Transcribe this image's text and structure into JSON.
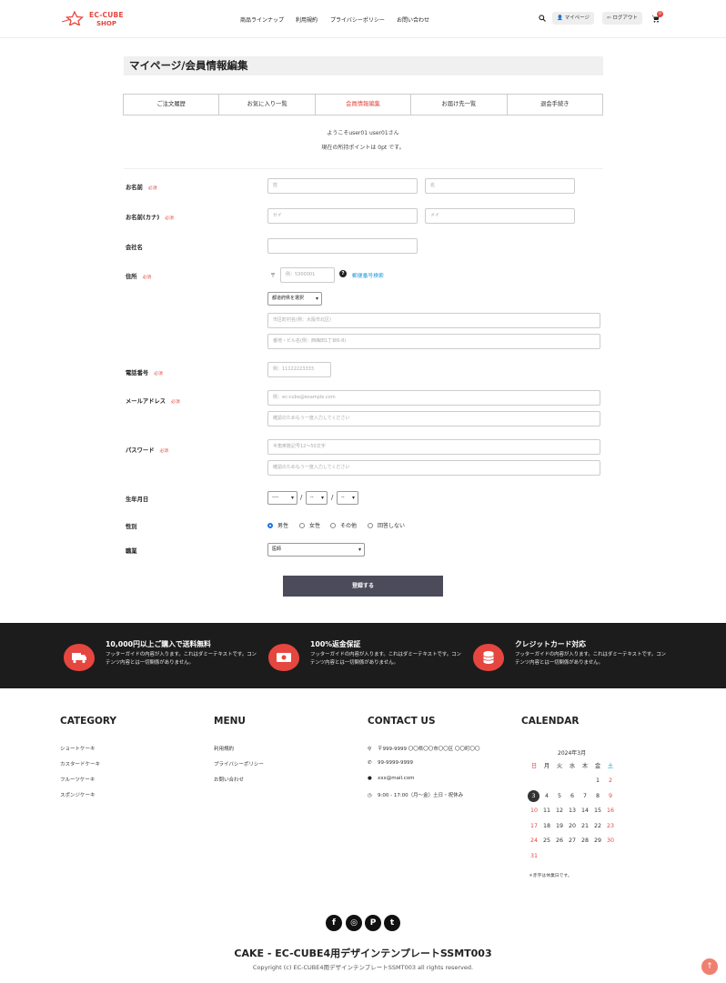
{
  "header": {
    "logo_line1": "EC-CUBE",
    "logo_line2": "SHOP",
    "nav": [
      "商品ラインナップ",
      "利用規約",
      "プライバシーポリシー",
      "お問い合わせ"
    ],
    "mypage": "マイページ",
    "logout": "ログアウト",
    "cart_count": "0"
  },
  "page": {
    "title": "マイページ/会員情報編集",
    "tabs": [
      "ご注文履歴",
      "お気に入り一覧",
      "会員情報編集",
      "お届け先一覧",
      "退会手続き"
    ],
    "active_tab": 2,
    "welcome": "ようこそuser01 user01さん",
    "points": "現在の所持ポイントは 0pt です。"
  },
  "form": {
    "required": "必須",
    "name_label": "お名前",
    "name_last_ph": "姓",
    "name_first_ph": "名",
    "kana_label": "お名前(カナ)",
    "kana_last_ph": "セイ",
    "kana_first_ph": "メイ",
    "company_label": "会社名",
    "address_label": "住所",
    "postal_mark": "〒",
    "postal_ph": "例：5300001",
    "postal_help": "?",
    "postal_search": "郵便番号検索",
    "pref_value": "都道府県を選択",
    "addr1_ph": "市区町村名(例：大阪市北区)",
    "addr2_ph": "番地・ビル名(例：西梅田1丁目6-8)",
    "phone_label": "電話番号",
    "phone_ph": "例：11122223333",
    "email_label": "メールアドレス",
    "email_ph": "例：ec-cube@example.com",
    "email_confirm_ph": "確認のためもう一度入力してください",
    "password_label": "パスワード",
    "password_ph": "半角英数記号12～50文字",
    "password_confirm_ph": "確認のためもう一度入力してください",
    "birth_label": "生年月日",
    "birth_year": "----",
    "birth_month": "--",
    "birth_day": "--",
    "birth_sep": "/",
    "gender_label": "性別",
    "genders": [
      "男性",
      "女性",
      "その他",
      "回答しない"
    ],
    "gender_selected": 0,
    "job_label": "職業",
    "job_value": "医師",
    "submit": "登録する"
  },
  "features": [
    {
      "title": "10,000円以上ご購入で送料無料",
      "desc": "フッターガイドの内容が入ります。これはダミーテキストです。コンテンツ内容とは一切関係がありません。",
      "icon": "truck-icon"
    },
    {
      "title": "100%返金保証",
      "desc": "フッターガイドの内容が入ります。これはダミーテキストです。コンテンツ内容とは一切関係がありません。",
      "icon": "money-icon"
    },
    {
      "title": "クレジットカード対応",
      "desc": "フッターガイドの内容が入ります。これはダミーテキストです。コンテンツ内容とは一切関係がありません。",
      "icon": "coins-icon"
    }
  ],
  "footer": {
    "category_title": "CATEGORY",
    "categories": [
      "ショートケーキ",
      "カスタードケーキ",
      "フルーツケーキ",
      "スポンジケーキ"
    ],
    "menu_title": "MENU",
    "menu": [
      "利用規約",
      "プライバシーポリシー",
      "お問い合わせ"
    ],
    "contact_title": "CONTACT US",
    "contact": [
      {
        "icon": "map-pin-icon",
        "text": "〒999-9999 〇〇県〇〇市〇〇区 〇〇町〇〇"
      },
      {
        "icon": "phone-icon",
        "text": "99-9999-9999"
      },
      {
        "icon": "globe-icon",
        "text": "xxx@mail.com"
      },
      {
        "icon": "clock-icon",
        "text": "9:00 - 17:00（月～金）土日・祝休み"
      }
    ],
    "calendar_title": "CALENDAR",
    "calendar_month": "2024年3月",
    "weekdays": [
      "日",
      "月",
      "火",
      "水",
      "木",
      "金",
      "土"
    ],
    "calendar_weeks": [
      [
        "",
        "",
        "",
        "",
        "",
        "1",
        "2"
      ],
      [
        "3",
        "4",
        "5",
        "6",
        "7",
        "8",
        "9"
      ],
      [
        "10",
        "11",
        "12",
        "13",
        "14",
        "15",
        "16"
      ],
      [
        "17",
        "18",
        "19",
        "20",
        "21",
        "22",
        "23"
      ],
      [
        "24",
        "25",
        "26",
        "27",
        "28",
        "29",
        "30"
      ],
      [
        "31",
        "",
        "",
        "",
        "",
        "",
        ""
      ]
    ],
    "today": "3",
    "calendar_note": "＊赤字は休業日です。",
    "social": [
      {
        "icon": "facebook-icon",
        "glyph": "f"
      },
      {
        "icon": "instagram-icon",
        "glyph": "◎"
      },
      {
        "icon": "pinterest-icon",
        "glyph": "P"
      },
      {
        "icon": "twitter-icon",
        "glyph": "t"
      }
    ],
    "site_title": "CAKE - EC-CUBE4用デザインテンプレートSSMT003",
    "copyright": "Copyright (c) EC-CUBE4用デザインテンプレートSSMT003 all rights reserved.",
    "to_top": "↑"
  },
  "colors": {
    "accent": "#e5463f",
    "dark_band": "#1c1c1c",
    "button": "#4b4b5a"
  }
}
